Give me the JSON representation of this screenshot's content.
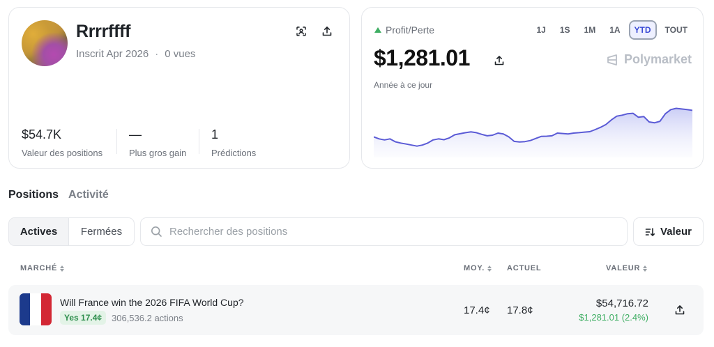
{
  "profile": {
    "username": "Rrrrffff",
    "joined": "Inscrit Apr 2026",
    "separator": "·",
    "views": "0 vues",
    "stats": [
      {
        "value": "$54.7K",
        "label": "Valeur des positions"
      },
      {
        "value": "—",
        "label": "Plus gros gain"
      },
      {
        "value": "1",
        "label": "Prédictions"
      }
    ],
    "icons": [
      "scan-icon",
      "share-icon"
    ]
  },
  "pnl": {
    "label": "Profit/Perte",
    "value": "$1,281.01",
    "since": "Année à ce jour",
    "brand": "Polymarket",
    "ranges": [
      "1J",
      "1S",
      "1M",
      "1A",
      "YTD",
      "TOUT"
    ],
    "active_range": "YTD",
    "accent_color": "#5b5bd6",
    "positive_color": "#3fae63"
  },
  "chart_data": {
    "type": "area",
    "y": [
      40,
      39,
      38.5,
      39,
      37.6,
      37,
      36.5,
      36,
      35.5,
      36,
      37,
      38.5,
      39,
      38.6,
      39.5,
      41,
      41.5,
      42,
      42.4,
      42,
      41.2,
      40.5,
      40.8,
      41.8,
      41.4,
      40,
      37.8,
      37.5,
      37.7,
      38.2,
      39.2,
      40.2,
      40.3,
      40.5,
      41.8,
      41.6,
      41.4,
      41.8,
      42,
      42.3,
      42.5,
      43.5,
      44.6,
      46,
      48.2,
      50,
      50.5,
      51.2,
      51.4,
      49.5,
      49.8,
      47.2,
      46.8,
      47.5,
      51.2,
      53.2,
      53.8,
      53.5,
      53.2,
      52.8
    ],
    "ylim": [
      30,
      57
    ],
    "line_color": "#5b5bd6",
    "fill_color": "#c9ccf5"
  },
  "positions": {
    "tabs": [
      "Positions",
      "Activité"
    ],
    "filters": [
      "Actives",
      "Fermées"
    ],
    "search_placeholder": "Rechercher des positions",
    "sort_label": "Valeur",
    "headers": {
      "market": "MARCHÉ",
      "avg": "MOY.",
      "current": "ACTUEL",
      "value": "VALEUR"
    },
    "rows": [
      {
        "title": "Will France win the 2026 FIFA World Cup?",
        "outcome": "Yes 17.4¢",
        "shares": "306,536.2 actions",
        "avg": "17.4¢",
        "current": "17.8¢",
        "value": "$54,716.72",
        "pnl": "$1,281.01 (2.4%)",
        "flag_colors": [
          "#1c3a8c",
          "#ffffff",
          "#d32734"
        ]
      }
    ]
  }
}
